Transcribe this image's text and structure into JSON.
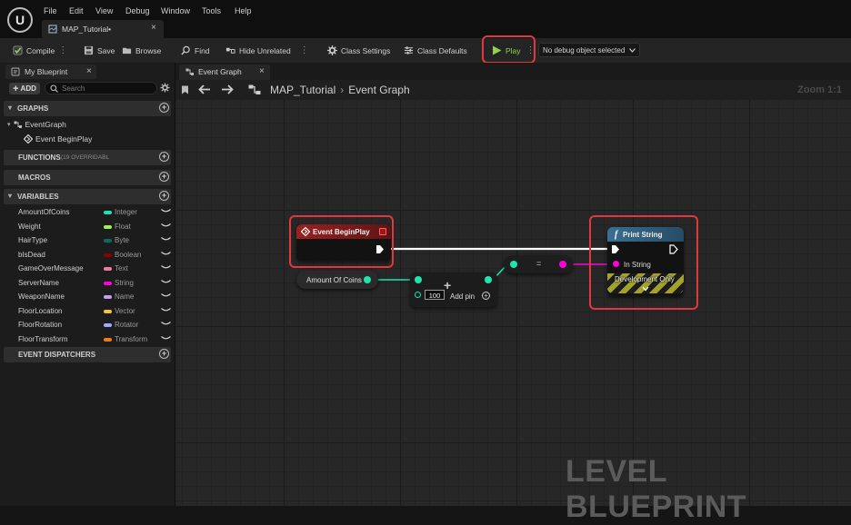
{
  "title_bar": {
    "menu": [
      "File",
      "Edit",
      "View",
      "Debug",
      "Window",
      "Tools",
      "Help"
    ],
    "asset_tab": "MAP_Tutorial•",
    "asset_tab_close": "×"
  },
  "toolbar": {
    "compile": "Compile",
    "save": "Save",
    "browse": "Browse",
    "find": "Find",
    "hide_unrelated": "Hide Unrelated",
    "class_settings": "Class Settings",
    "class_defaults": "Class Defaults",
    "play": "Play",
    "debug_object": "No debug object selected",
    "more": "⋮"
  },
  "my_blueprint": {
    "tab": "My Blueprint",
    "tab_close": "×",
    "add": "ADD",
    "search_placeholder": "Search",
    "sections": {
      "graphs": "GRAPHS",
      "functions": "FUNCTIONS",
      "functions_note": "(19 OVERRIDABL",
      "macros": "MACROS",
      "variables": "VARIABLES",
      "event_dispatchers": "EVENT DISPATCHERS"
    },
    "graph_tree": {
      "event_graph": "EventGraph",
      "event_begin_play": "Event BeginPlay"
    },
    "variables": [
      {
        "name": "AmountOfCoins",
        "type": "Integer",
        "color": "#1fe3b0"
      },
      {
        "name": "Weight",
        "type": "Float",
        "color": "#9ef24f"
      },
      {
        "name": "HairType",
        "type": "Byte",
        "color": "#0b6b61"
      },
      {
        "name": "bIsDead",
        "type": "Boolean",
        "color": "#8c0000"
      },
      {
        "name": "GameOverMessage",
        "type": "Text",
        "color": "#e87ea3"
      },
      {
        "name": "ServerName",
        "type": "String",
        "color": "#ff00d9"
      },
      {
        "name": "WeaponName",
        "type": "Name",
        "color": "#c59cf2"
      },
      {
        "name": "FloorLocation",
        "type": "Vector",
        "color": "#f7c42f"
      },
      {
        "name": "FloorRotation",
        "type": "Rotator",
        "color": "#9fa9ff"
      },
      {
        "name": "FloorTransform",
        "type": "Transform",
        "color": "#f07b1a"
      }
    ]
  },
  "graph": {
    "tab": "Event Graph",
    "tab_close": "×",
    "breadcrumb_root": "MAP_Tutorial",
    "breadcrumb_sep": "›",
    "breadcrumb_current": "Event Graph",
    "zoom": "Zoom 1:1",
    "nodes": {
      "begin_play": "Event BeginPlay",
      "amount_of_coins": "Amount Of Coins",
      "add_value": "100",
      "add_pin": "Add pin",
      "convert_symbol": "=",
      "print_string": "Print String",
      "in_string": "In String",
      "dev_only": "Development Only"
    },
    "watermark": "LEVEL BLUEPRINT"
  },
  "colors": {
    "highlight": "#e0383e",
    "exec": "#ffffff",
    "integer": "#1fe3b0",
    "string": "#ff00d9",
    "event_header": "#8e1c1c",
    "function_header": "#2f5f80",
    "play_green": "#8fd14f"
  },
  "icons": {
    "logo": "unreal-engine-logo-icon",
    "compile": "compile-check-icon",
    "save": "save-disk-icon",
    "browse": "browse-folder-icon",
    "find": "find-magnifier-icon",
    "hide_unrelated": "hide-unrelated-icon",
    "class_settings": "gear-icon",
    "class_defaults": "sliders-icon",
    "play": "play-triangle-icon"
  }
}
